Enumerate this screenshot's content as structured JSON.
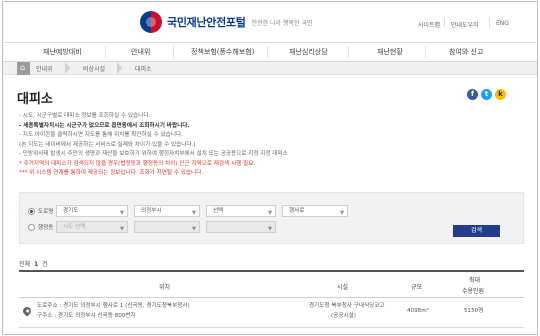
{
  "header": {
    "title": "국민재난안전포털",
    "subtitle": "안전한 나라 행복한 국민",
    "util_links": [
      "사이트맵",
      "안내도우미",
      "ENG"
    ]
  },
  "gnb": [
    "재난예방대비",
    "안내위",
    "정책보험(풍수해보험)",
    "재난심리상담",
    "재난현황",
    "참여와 신고"
  ],
  "breadcrumb": [
    "안내위",
    "비상시설",
    "대피소"
  ],
  "page_title": "대피소",
  "share": [
    "f",
    "t",
    "k"
  ],
  "notes": [
    {
      "text": "- 시도, 시군구별로 대피소 정보를 조회하실 수 있습니다.",
      "style": "normal"
    },
    {
      "text": "- 세종특별자치시는 시군구가 없으므로 읍면동에서 조회하시기 바랍니다.",
      "style": "bold"
    },
    {
      "text": "- 지도 아이콘을 클릭하시면 지도를 통해 위치를 확인하실 수 있습니다.",
      "style": "normal"
    },
    {
      "text": "(본 지도는 네이버에서 제공하는 서비스로 실제와 차이가 있을 수 있습니다.)",
      "style": "normal"
    },
    {
      "text": "- 민방위사태 발생시 주민의 생명과 재산을 보호하기 위하여 행정자치부에서 설치 또는 공공용으로 지정 지정 대피소",
      "style": "normal"
    },
    {
      "text": "* 주거지역의 대피소가 검색되지 않을 경우(법정동과 행정동의 차이) 인근 지역으로 재검색 시행 필요.",
      "style": "red"
    },
    {
      "text": "*** 위 시스템 연계를 통하여 제공되는 정보입니다. 조회가 지연될 수 있습니다.",
      "style": "red"
    }
  ],
  "search": {
    "row1": {
      "label": "도로명",
      "selected": true,
      "fields": [
        "경기도",
        "의정부시",
        "선택",
        "행사로"
      ]
    },
    "row2": {
      "label": "행정동",
      "selected": false,
      "fields": [
        "시도 선택",
        "",
        "",
        ""
      ]
    },
    "button": "검색"
  },
  "count": {
    "prefix": "전체",
    "value": "1",
    "suffix": "건"
  },
  "table": {
    "headers": [
      "위치",
      "시설",
      "규모",
      "최대",
      "수용인원"
    ],
    "rows": [
      {
        "addr1": "도로주소 : 경기도 의정부시 행사로 1 (신곡동, 경기도청북부청사)",
        "addr2": "구주소 : 경기도 의정부시 신곡동 800번지",
        "facility1": "경기도청 북부청사 구내식당코고",
        "facility2": "(공공시설)",
        "size": "4098m²",
        "capacity": "5150명"
      }
    ]
  }
}
